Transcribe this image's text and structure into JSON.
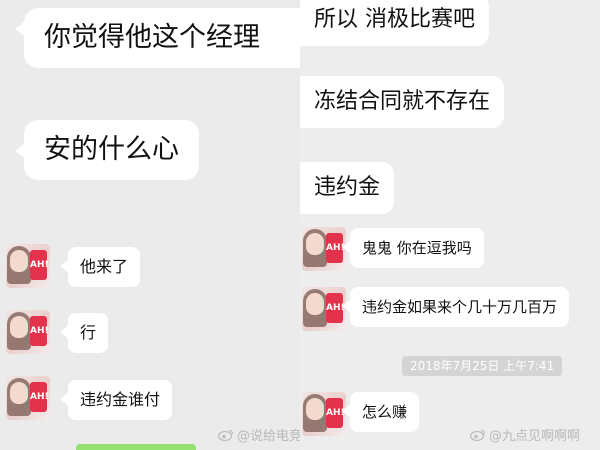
{
  "left_panel": {
    "messages": [
      {
        "text": "你觉得他这个经理",
        "avatar": false
      },
      {
        "text": "安的什么心",
        "avatar": false
      },
      {
        "text": "他来了",
        "avatar": true
      },
      {
        "text": "行",
        "avatar": true
      },
      {
        "text": "违约金谁付",
        "avatar": true
      }
    ],
    "avatar_badge": "AH!"
  },
  "right_panel": {
    "messages": [
      {
        "text": "所以 消极比赛吧",
        "avatar": false
      },
      {
        "text": "冻结合同就不存在",
        "avatar": false
      },
      {
        "text": "违约金",
        "avatar": false
      },
      {
        "text": "鬼鬼 你在逗我吗",
        "avatar": true
      },
      {
        "text": "违约金如果来个几十万几百万",
        "avatar": true
      },
      {
        "text": "怎么赚",
        "avatar": true
      }
    ],
    "timestamp": "2018年7月25日 上午7:41"
  },
  "watermarks": {
    "left": "@说给电竞者美人",
    "right": "@九点见啊啊啊"
  },
  "colors": {
    "background": "#ebebeb",
    "bubble": "#ffffff",
    "sent_bubble": "#94e070",
    "timestamp_bg": "#d4d4d4"
  },
  "icons": [
    "weibo-icon",
    "avatar-photo"
  ]
}
